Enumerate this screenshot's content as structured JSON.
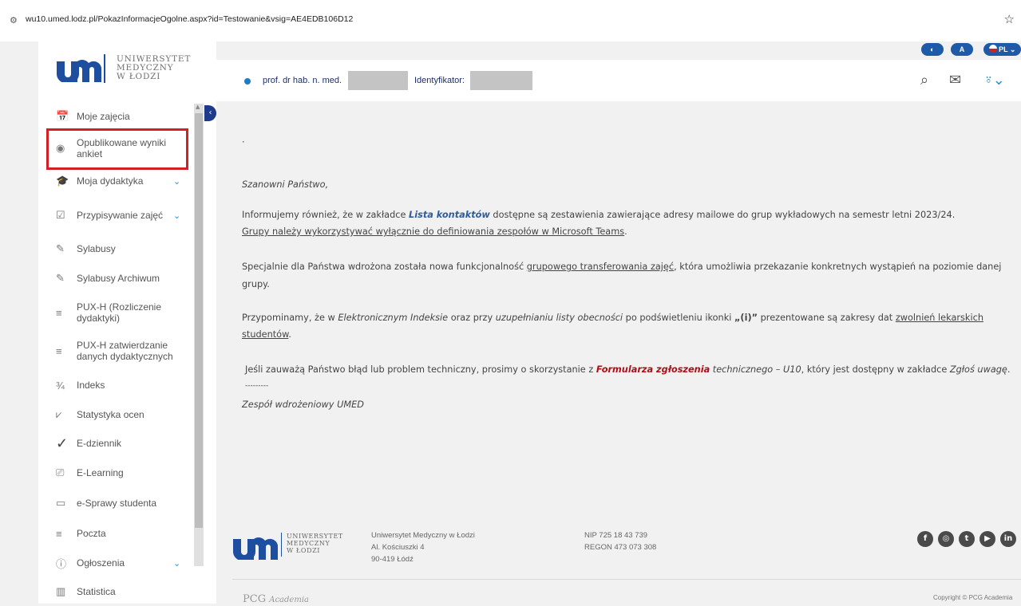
{
  "browser": {
    "url": "wu10.umed.lodz.pl/PokazInformacjeOgolne.aspx?id=Testowanie&vsig=AE4EDB106D12"
  },
  "logo": {
    "line1": "UNIWERSYTET",
    "line2": "MEDYCZNY",
    "line3": "W ŁODZI"
  },
  "sidebar": {
    "items": [
      {
        "label": "Moje zajęcia",
        "icon": "calendar-icon",
        "glyph": "📅"
      },
      {
        "label": "Opublikowane wyniki ankiet",
        "icon": "radio-icon",
        "glyph": "◉"
      },
      {
        "label": "Moja dydaktyka",
        "icon": "graduation-icon",
        "glyph": "🎓",
        "expand": "⌄"
      },
      {
        "label": "Przypisywanie zajęć",
        "icon": "checkbox-icon",
        "glyph": "☑",
        "expand": "⌄"
      },
      {
        "label": "Sylabusy",
        "icon": "edit-icon",
        "glyph": "✎"
      },
      {
        "label": "Sylabusy Archiwum",
        "icon": "edit-icon",
        "glyph": "✎"
      },
      {
        "label": "PUX-H (Rozliczenie dydaktyki)",
        "icon": "list-icon",
        "glyph": "≡"
      },
      {
        "label": "PUX-H zatwierdzanie danych dydaktycznych",
        "icon": "list-icon",
        "glyph": "≡"
      },
      {
        "label": "Indeks",
        "icon": "fraction-icon",
        "glyph": "¾"
      },
      {
        "label": "Statystyka ocen",
        "icon": "chart-icon",
        "glyph": "⩗"
      },
      {
        "label": "E-dziennik",
        "icon": "checkmark-icon",
        "glyph": "✓"
      },
      {
        "label": "E-Learning",
        "icon": "elearning-icon",
        "glyph": "⎚"
      },
      {
        "label": "e-Sprawy studenta",
        "icon": "comment-icon",
        "glyph": "▭"
      },
      {
        "label": "Poczta",
        "icon": "list-icon",
        "glyph": "≡"
      },
      {
        "label": "Ogłoszenia",
        "icon": "info-icon",
        "glyph": "ⓘ",
        "expand": "⌄"
      },
      {
        "label": "Statistica",
        "icon": "bars-icon",
        "glyph": "▥"
      }
    ]
  },
  "topbar": {
    "name": "prof. dr hab. n. med.",
    "id_label": "Identyfikator:",
    "lang": "PL"
  },
  "content": {
    "dot": "·",
    "greeting": "Szanowni Państwo,",
    "p1_a": "Informujemy również, że w zakładce ",
    "p1_link": "Lista kontaktów",
    "p1_b": " dostępne są zestawienia zawierające adresy mailowe do grup wykładowych na semestr letni 2023/24.",
    "p1_line2": "Grupy należy wykorzystywać wyłącznie do definiowania zespołów w Microsoft Teams",
    "p1_line2_end": ".",
    "p2_a": "Specjalnie dla Państwa wdrożona została nowa funkcjonalność ",
    "p2_link": "grupowego transferowania zajęć",
    "p2_b": ", która umożliwia przekazanie konkretnych wystąpień na poziomie danej",
    "p2_line2": "grupy.",
    "p3_a": "Przypominamy, że w ",
    "p3_i1": "Elektronicznym Indeksie",
    "p3_b": " oraz przy ",
    "p3_i2": "uzupełnianiu listy obecności",
    "p3_c": " po podświetleniu ikonki ",
    "p3_bold": "„(i)”",
    "p3_d": "  prezentowane są zakresy dat ",
    "p3_link": "zwolnień lekarskich",
    "p3_line2": "studentów",
    "p3_line2_end": ".",
    "p4_a": "Jeśli zauważą Państwo błąd lub problem techniczny, prosimy o skorzystanie z ",
    "p4_link": "Formularza zgłoszenia",
    "p4_i": " technicznego – U10",
    "p4_b": ", który jest dostępny w zakładce ",
    "p4_i2": "Zgłoś uwagę",
    "p4_end": ".",
    "sep": "---------",
    "sign": "Zespół wdrożeniowy UMED"
  },
  "footer": {
    "addr1": "Uniwersytet Medyczny w Łodzi",
    "addr2": "Al. Kościuszki 4",
    "addr3": "90-419 Łódź",
    "nip": "NIP 725 18 43 739",
    "regon": "REGON 473 073 308",
    "brand": "PCG",
    "brand2": "Academia",
    "copyright": "Copyright © PCG Academia"
  }
}
